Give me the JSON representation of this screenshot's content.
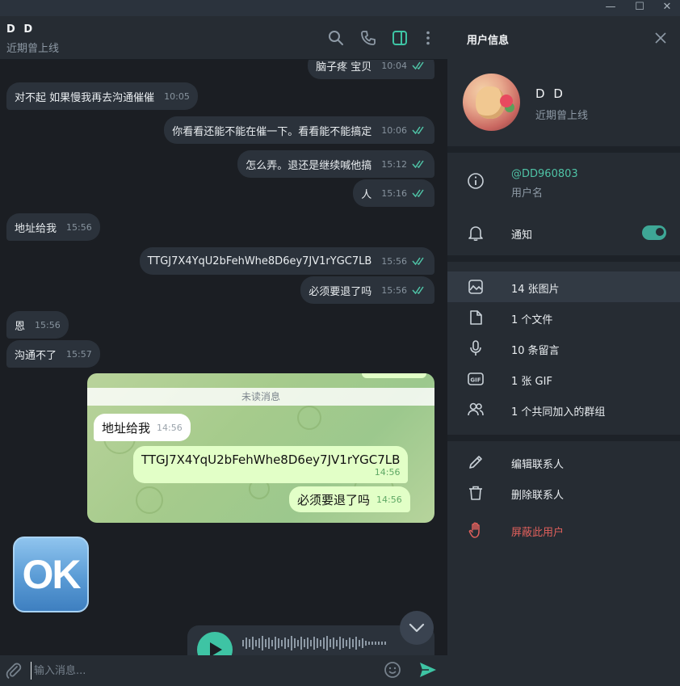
{
  "window": {
    "minimize": "—",
    "maximize": "☐",
    "close": "✕"
  },
  "chat": {
    "header": {
      "name": "D D",
      "status": "近期曾上线"
    },
    "messages": [
      {
        "dir": "out",
        "text": "脑子疼 宝贝",
        "time": "10:04",
        "read": true
      },
      {
        "dir": "in",
        "text": "对不起 如果慢我再去沟通催催",
        "time": "10:05"
      },
      {
        "dir": "out",
        "text": "你看看还能不能在催一下。看看能不能搞定",
        "time": "10:06",
        "read": true
      },
      {
        "dir": "out",
        "text": "怎么弄。退还是继续喊他搞",
        "time": "15:12",
        "read": true
      },
      {
        "dir": "out",
        "text": "人",
        "time": "15:16",
        "read": true
      },
      {
        "dir": "in",
        "text": "地址给我",
        "time": "15:56"
      },
      {
        "dir": "out",
        "text": "TTGJ7X4YqU2bFehWhe8D6ey7JV1rYGC7LB",
        "time": "15:56",
        "read": true
      },
      {
        "dir": "out",
        "text": "必须要退了吗",
        "time": "15:56",
        "read": true
      },
      {
        "dir": "in",
        "text": "恩",
        "time": "15:56"
      },
      {
        "dir": "in",
        "text": "沟通不了",
        "time": "15:57"
      }
    ],
    "screenshot": {
      "unread_label": "未读消息",
      "messages": [
        {
          "dir": "in",
          "text": "地址给我",
          "time": "14:56"
        },
        {
          "dir": "out",
          "text": "TTGJ7X4YqU2bFehWhe8D6ey7JV1rYGC7LB",
          "time": "14:56"
        },
        {
          "dir": "out",
          "text": "必须要退了吗",
          "time": "14:56"
        }
      ]
    },
    "sticker_text": "OK",
    "composer": {
      "placeholder": "输入消息..."
    },
    "accent": "#3ec4a4"
  },
  "profile": {
    "title": "用户信息",
    "name": "D D",
    "status": "近期曾上线",
    "username": "@DD960803",
    "username_label": "用户名",
    "notifications_label": "通知",
    "notifications_on": true,
    "media": [
      {
        "icon": "image-icon",
        "label": "14 张图片"
      },
      {
        "icon": "file-icon",
        "label": "1 个文件"
      },
      {
        "icon": "microphone-icon",
        "label": "10 条留言"
      },
      {
        "icon": "gif-icon",
        "label": "1 张 GIF"
      },
      {
        "icon": "users-icon",
        "label": "1 个共同加入的群组"
      }
    ],
    "actions": [
      {
        "icon": "pencil-icon",
        "label": "编辑联系人"
      },
      {
        "icon": "trash-icon",
        "label": "删除联系人"
      },
      {
        "icon": "hand-icon",
        "label": "屏蔽此用户",
        "danger": true
      }
    ],
    "danger_color": "#e0605c"
  }
}
